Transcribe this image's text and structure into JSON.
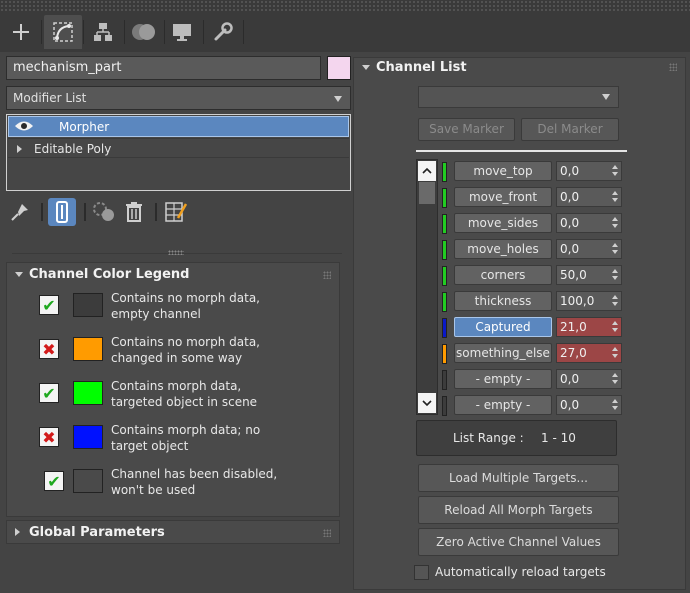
{
  "tabs": [
    {
      "name": "create",
      "icon": "plus-icon",
      "active": false
    },
    {
      "name": "modify",
      "icon": "modify-curve-icon",
      "active": true
    },
    {
      "name": "hierarchy",
      "icon": "hierarchy-icon",
      "active": false
    },
    {
      "name": "motion",
      "icon": "motion-icon",
      "active": false
    },
    {
      "name": "display",
      "icon": "display-monitor-icon",
      "active": false
    },
    {
      "name": "utilities",
      "icon": "wrench-icon",
      "active": false
    }
  ],
  "object_name": "mechanism_part",
  "object_color": "#f4d6ee",
  "modifier_list": "Modifier List",
  "stack": {
    "items": [
      {
        "label": "Morpher",
        "selected": true
      },
      {
        "label": "Editable Poly",
        "selected": false
      }
    ]
  },
  "legend": {
    "title": "Channel Color Legend",
    "rows": [
      {
        "check": "✔",
        "check_color": "#1fa81f",
        "swatch": "#3c3c3c",
        "line1": "Contains no morph data,",
        "line2": "empty channel"
      },
      {
        "check": "✖",
        "check_color": "#d21a1a",
        "swatch": "#ff9b00",
        "line1": "Contains no morph data,",
        "line2": "changed in some way"
      },
      {
        "check": "✔",
        "check_color": "#1fa81f",
        "swatch": "#00ff00",
        "line1": "Contains morph data,",
        "line2": "targeted object in scene"
      },
      {
        "check": "✖",
        "check_color": "#d21a1a",
        "swatch": "#0011ff",
        "line1": "Contains morph data; no",
        "line2": "target object"
      },
      {
        "check": "✔",
        "check_color": "#1fa81f",
        "swatch": "#4a4a4a",
        "line1": "Channel has been disabled,",
        "line2": "won't be used"
      }
    ]
  },
  "global_params": {
    "title": "Global Parameters"
  },
  "channel_list": {
    "title": "Channel List",
    "save_marker": "Save Marker",
    "del_marker": "Del Marker",
    "channels": [
      {
        "name": "move_top",
        "value": "0,0",
        "color": "#22cc22",
        "selected": false,
        "highlight": false
      },
      {
        "name": "move_front",
        "value": "0,0",
        "color": "#22cc22",
        "selected": false,
        "highlight": false
      },
      {
        "name": "move_sides",
        "value": "0,0",
        "color": "#22cc22",
        "selected": false,
        "highlight": false
      },
      {
        "name": "move_holes",
        "value": "0,0",
        "color": "#22cc22",
        "selected": false,
        "highlight": false
      },
      {
        "name": "corners",
        "value": "50,0",
        "color": "#22cc22",
        "selected": false,
        "highlight": false
      },
      {
        "name": "thickness",
        "value": "100,0",
        "color": "#22cc22",
        "selected": false,
        "highlight": false
      },
      {
        "name": "Captured",
        "value": "21,0",
        "color": "#0a18c8",
        "selected": true,
        "highlight": true
      },
      {
        "name": "something_else",
        "value": "27,0",
        "color": "#ff9b00",
        "selected": false,
        "highlight": true
      },
      {
        "name": "- empty -",
        "value": "0,0",
        "color": "#3c3c3c",
        "selected": false,
        "highlight": false
      },
      {
        "name": "- empty -",
        "value": "0,0",
        "color": "#3c3c3c",
        "selected": false,
        "highlight": false
      }
    ],
    "list_range_label": "List Range :",
    "list_range_value": "1 - 10",
    "load_multiple": "Load Multiple Targets...",
    "reload_all": "Reload All Morph Targets",
    "zero_active": "Zero Active Channel Values",
    "auto_reload": "Automatically reload targets"
  }
}
